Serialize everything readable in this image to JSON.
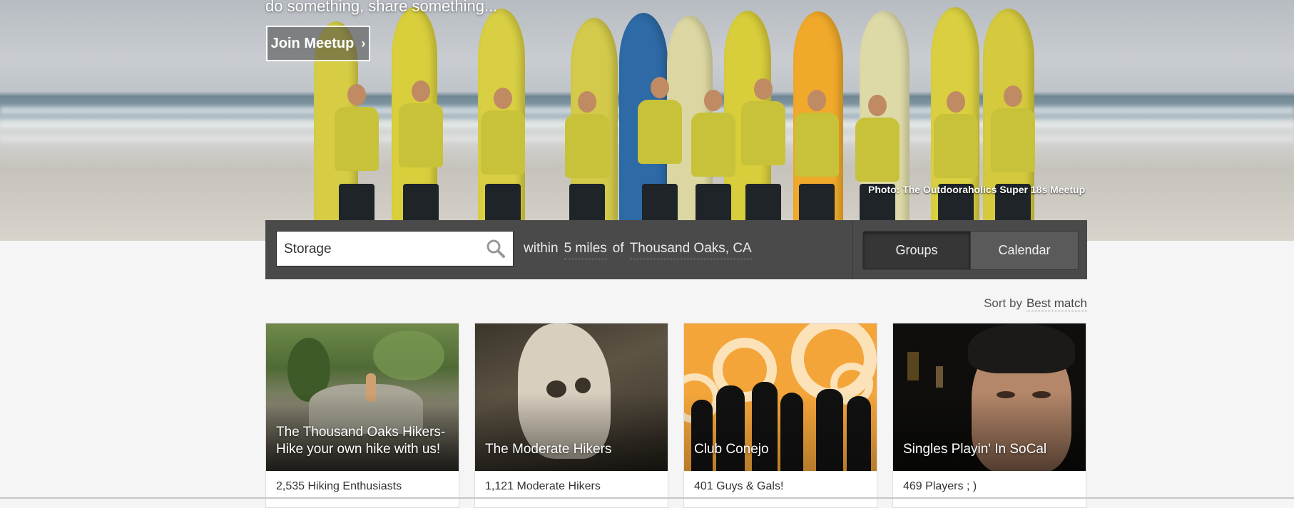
{
  "hero": {
    "tagline": "do something, share something...",
    "join_button": "Join Meetup",
    "join_chevron": "›",
    "photo_credit": "Photo: The Outdooraholics Super 18s Meetup"
  },
  "search": {
    "query": "Storage",
    "placeholder": "",
    "within_label": "within",
    "distance": "5 miles",
    "of_label": "of",
    "location": "Thousand Oaks, CA",
    "icon": "search-icon"
  },
  "view_toggle": {
    "groups": "Groups",
    "calendar": "Calendar",
    "active": "Groups"
  },
  "sort": {
    "label": "Sort by",
    "value": "Best match"
  },
  "cards": [
    {
      "name": "The Thousand Oaks Hikers-Hike your own hike with us!",
      "members": "2,535 Hiking Enthusiasts"
    },
    {
      "name": "The Moderate Hikers",
      "members": "1,121 Moderate Hikers"
    },
    {
      "name": "Club Conejo",
      "members": "401 Guys & Gals!"
    },
    {
      "name": "Singles Playin' In SoCal",
      "members": "469 Players ; )"
    }
  ],
  "colors": {
    "search_bar_bg": "#4a4a4a",
    "page_bg": "#f5f5f5",
    "card_orange": "#f4a53a"
  }
}
